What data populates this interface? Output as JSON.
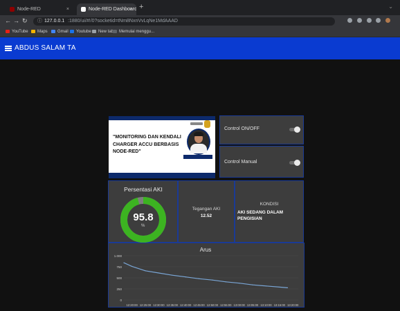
{
  "browser": {
    "tabs": [
      {
        "title": "Node-RED",
        "active": false
      },
      {
        "title": "Node-RED Dashboard",
        "active": true
      }
    ],
    "new_tab": "+",
    "url_host": "127.0.0.1",
    "url_path": ":1880/ui/#!/0?socketid=tNm8NxnVvLqNe1MdAAAD",
    "bookmarks": [
      {
        "label": "YouTube",
        "color": "#e62117"
      },
      {
        "label": "Maps",
        "color": "#f4b400"
      },
      {
        "label": "Gmail",
        "color": "#4285f4"
      },
      {
        "label": "Youtube",
        "color": "#1a73e8"
      },
      {
        "label": "New tab",
        "color": "#9aa0a6"
      },
      {
        "label": "Memulai menggu...",
        "color": "#5f6368"
      }
    ]
  },
  "app": {
    "title": "ABDUS SALAM TA"
  },
  "banner": {
    "title": "\"MONITORING DAN KENDALI CHARGER ACCU BERBASIS NODE-RED\""
  },
  "controls": {
    "onoff_label": "Control ON/OFF",
    "onoff_state": false,
    "manual_label": "Control Manual",
    "manual_state": false
  },
  "gauge": {
    "title": "Persentasi AKI",
    "value": "95.8",
    "unit": "%",
    "percent": 95.8,
    "color_fill": "#3cb321",
    "color_track": "#7d7d7d"
  },
  "voltage": {
    "label": "Tegangan AKI",
    "value": "12.52"
  },
  "condition": {
    "label": "KONDISI",
    "value": "AKI SEDANG DALAM PENGISIAN"
  },
  "colors": {
    "accent": "#0a3bd1",
    "card": "#3d3d3d",
    "line": "#7aa6d6"
  },
  "chart_data": {
    "type": "line",
    "title": "Arus",
    "ylim": [
      0,
      1000
    ],
    "y_ticks": [
      {
        "value": 0,
        "label": "0"
      },
      {
        "value": 250,
        "label": "250"
      },
      {
        "value": 500,
        "label": "500"
      },
      {
        "value": 750,
        "label": "750"
      },
      {
        "value": 1000,
        "label": "1.000"
      }
    ],
    "x_ticks": [
      "12:20:00",
      "12:25:00",
      "12:30:00",
      "12:35:00",
      "12:40:00",
      "12:45:00",
      "12:50:00",
      "12:55:00",
      "13:00:00",
      "13:05:00",
      "13:10:00",
      "13:15:00",
      "13:20:00"
    ],
    "series": [
      {
        "x": [
          "12:17:00",
          "12:20:00",
          "12:25:00",
          "12:30:00",
          "12:35:00",
          "12:40:00",
          "12:45:00",
          "12:50:00",
          "12:55:00",
          "13:00:00",
          "13:05:00",
          "13:10:00",
          "13:15:00",
          "13:18:00"
        ],
        "y": [
          840,
          760,
          660,
          610,
          560,
          520,
          480,
          450,
          410,
          380,
          340,
          315,
          290,
          275
        ]
      }
    ]
  }
}
